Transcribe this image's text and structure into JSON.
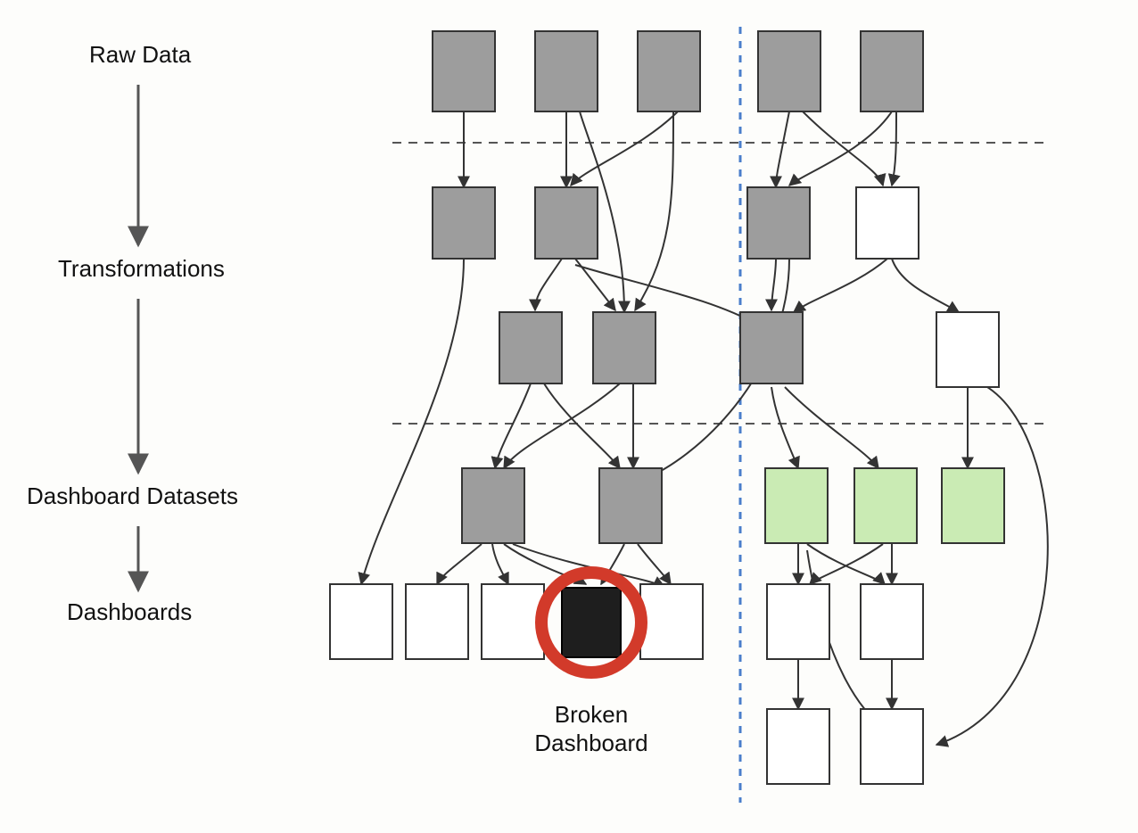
{
  "labels": {
    "raw_data": "Raw Data",
    "transformations": "Transformations",
    "dashboard_datasets": "Dashboard Datasets",
    "dashboards": "Dashboards",
    "broken_line1": "Broken",
    "broken_line2": "Dashboard"
  },
  "diagram": {
    "node_colors": {
      "gray": "#9d9d9d",
      "white": "#ffffff",
      "green": "#caebb4",
      "dark": "#1e1e1e"
    },
    "highlight_ring_color": "#d23a2a",
    "vertical_divider_color": "#4a7ecb",
    "stages": [
      "Raw Data",
      "Transformations",
      "Dashboard Datasets",
      "Dashboards"
    ],
    "nodes": {
      "r1": {
        "row": "raw",
        "color": "gray"
      },
      "r2": {
        "row": "raw",
        "color": "gray"
      },
      "r3": {
        "row": "raw",
        "color": "gray"
      },
      "r4": {
        "row": "raw",
        "color": "gray"
      },
      "r5": {
        "row": "raw",
        "color": "gray"
      },
      "t1a": {
        "row": "transform1",
        "color": "gray"
      },
      "t1b": {
        "row": "transform1",
        "color": "gray"
      },
      "t1c": {
        "row": "transform1",
        "color": "gray"
      },
      "t1d": {
        "row": "transform1",
        "color": "white"
      },
      "t2a": {
        "row": "transform2",
        "color": "gray"
      },
      "t2b": {
        "row": "transform2",
        "color": "gray"
      },
      "t2c": {
        "row": "transform2",
        "color": "gray"
      },
      "t2d": {
        "row": "transform2",
        "color": "white"
      },
      "ds1": {
        "row": "dataset",
        "color": "gray"
      },
      "ds2": {
        "row": "dataset",
        "color": "gray"
      },
      "ds3": {
        "row": "dataset",
        "color": "green"
      },
      "ds4": {
        "row": "dataset",
        "color": "green"
      },
      "ds5": {
        "row": "dataset",
        "color": "green"
      },
      "d1": {
        "row": "dash1",
        "color": "white"
      },
      "d2": {
        "row": "dash1",
        "color": "white"
      },
      "d3": {
        "row": "dash1",
        "color": "white"
      },
      "d4": {
        "row": "dash1",
        "color": "dark",
        "broken": true
      },
      "d5": {
        "row": "dash1",
        "color": "white"
      },
      "d6": {
        "row": "dash1",
        "color": "white"
      },
      "d7": {
        "row": "dash1",
        "color": "white"
      },
      "d8": {
        "row": "dash2",
        "color": "white"
      },
      "d9": {
        "row": "dash2",
        "color": "white"
      }
    },
    "edges": [
      [
        "r1",
        "t1a"
      ],
      [
        "r2",
        "t1b"
      ],
      [
        "r2",
        "t1c"
      ],
      [
        "r3",
        "t1b"
      ],
      [
        "r3",
        "t2b"
      ],
      [
        "r4",
        "t1c"
      ],
      [
        "r4",
        "t1d"
      ],
      [
        "r5",
        "t1c"
      ],
      [
        "r5",
        "t1d"
      ],
      [
        "t1a",
        "d1"
      ],
      [
        "t1b",
        "t2a"
      ],
      [
        "t1b",
        "t2b"
      ],
      [
        "t1b",
        "t2c"
      ],
      [
        "t1c",
        "t2c"
      ],
      [
        "t1c",
        "ds2"
      ],
      [
        "t1d",
        "t2c"
      ],
      [
        "t1d",
        "t2d"
      ],
      [
        "t2a",
        "ds1"
      ],
      [
        "t2a",
        "ds2"
      ],
      [
        "t2b",
        "ds1"
      ],
      [
        "t2b",
        "ds2"
      ],
      [
        "t2c",
        "ds3"
      ],
      [
        "t2c",
        "ds4"
      ],
      [
        "t2d",
        "ds5"
      ],
      [
        "t2d",
        "d9"
      ],
      [
        "ds1",
        "d2"
      ],
      [
        "ds1",
        "d3"
      ],
      [
        "ds1",
        "d4"
      ],
      [
        "ds1",
        "d5"
      ],
      [
        "ds2",
        "d4"
      ],
      [
        "ds2",
        "d5"
      ],
      [
        "ds3",
        "d6"
      ],
      [
        "ds3",
        "d7"
      ],
      [
        "ds3",
        "d9"
      ],
      [
        "ds4",
        "d6"
      ],
      [
        "ds4",
        "d7"
      ],
      [
        "d6",
        "d8"
      ],
      [
        "d7",
        "d9"
      ]
    ]
  }
}
